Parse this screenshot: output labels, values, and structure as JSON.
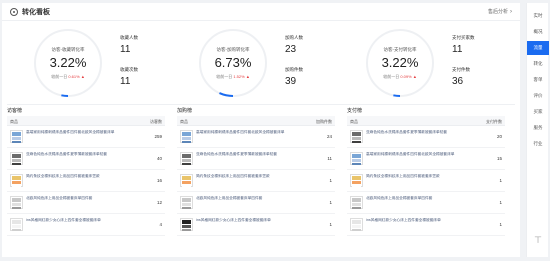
{
  "header": {
    "title": "转化看板",
    "link_label": "售后分析",
    "icon": "settings-icon"
  },
  "metrics": [
    {
      "ring_label": "访客-收藏转化率",
      "ring_value": "3.22%",
      "compare_label": "较前一日",
      "compare_value": "0.61%",
      "compare_arrow": "▲",
      "progress_fraction": 0.0322,
      "kpis": [
        {
          "label": "收藏人数",
          "value": "11"
        },
        {
          "label": "收藏次数",
          "value": "11"
        }
      ]
    },
    {
      "ring_label": "访客-加购转化率",
      "ring_value": "6.73%",
      "compare_label": "较前一日",
      "compare_value": "1.52%",
      "compare_arrow": "▲",
      "progress_fraction": 0.0673,
      "kpis": [
        {
          "label": "加购人数",
          "value": "23"
        },
        {
          "label": "加购件数",
          "value": "39"
        }
      ]
    },
    {
      "ring_label": "访客-支付转化率",
      "ring_value": "3.22%",
      "compare_label": "较前一日",
      "compare_value": "0.09%",
      "compare_arrow": "▲",
      "progress_fraction": 0.0322,
      "kpis": [
        {
          "label": "支付买家数",
          "value": "11"
        },
        {
          "label": "支付件数",
          "value": "36"
        }
      ]
    }
  ],
  "rankings": [
    {
      "title": "访客榜",
      "col_product": "商品",
      "col_value": "访客数",
      "rows": [
        {
          "title": "高端家用纯棉刺绣床品套件四件套北欧风全棉被套床单",
          "value": "259",
          "thumb": "blue"
        },
        {
          "title": "亚麻色纯色水洗棉床品套件夏季薄款被套床单枕套",
          "value": "40",
          "thumb": "dark"
        },
        {
          "title": "简约条纹全棉斜纹床上用品四件套被套床笠款",
          "value": "16",
          "thumb": "yellow"
        },
        {
          "title": "北欧风纯色床上用品全棉被套床单四件套",
          "value": "12",
          "thumb": "gray"
        },
        {
          "title": "ins风格网红款少女心床上四件套全棉被套床单",
          "value": "4",
          "thumb": "white"
        }
      ]
    },
    {
      "title": "加购榜",
      "col_product": "商品",
      "col_value": "加购件数",
      "rows": [
        {
          "title": "高端家用纯棉刺绣床品套件四件套北欧风全棉被套床单",
          "value": "24",
          "thumb": "blue"
        },
        {
          "title": "亚麻色纯色水洗棉床品套件夏季薄款被套床单枕套",
          "value": "11",
          "thumb": "dark"
        },
        {
          "title": "简约条纹全棉斜纹床上用品四件套被套床笠款",
          "value": "1",
          "thumb": "yellow"
        },
        {
          "title": "北欧风纯色床上用品全棉被套床单四件套",
          "value": "1",
          "thumb": "gray"
        },
        {
          "title": "ins风格网红款少女心床上四件套全棉被套床单",
          "value": "1",
          "thumb": "black"
        }
      ]
    },
    {
      "title": "支付榜",
      "col_product": "商品",
      "col_value": "支付件数",
      "rows": [
        {
          "title": "亚麻色纯色水洗棉床品套件夏季薄款被套床单枕套",
          "value": "20",
          "thumb": "dark"
        },
        {
          "title": "高端家用纯棉刺绣床品套件四件套北欧风全棉被套床单",
          "value": "15",
          "thumb": "blue"
        },
        {
          "title": "简约条纹全棉斜纹床上用品四件套被套床笠款",
          "value": "1",
          "thumb": "yellow"
        },
        {
          "title": "北欧风纯色床上用品全棉被套床单四件套",
          "value": "1",
          "thumb": "gray"
        },
        {
          "title": "ins风格网红款少女心床上四件套全棉被套床单",
          "value": "1",
          "thumb": "white"
        }
      ]
    }
  ],
  "sidebar": {
    "items": [
      "实时",
      "概况",
      "流量",
      "转化",
      "客单",
      "评价",
      "买家",
      "服务",
      "行业"
    ],
    "active_index": 2,
    "top_icon": "pin-to-top-icon",
    "top_glyph": "⊤"
  },
  "colors": {
    "accent": "#1a6bf0",
    "up": "#e4393c",
    "ring_track": "#eef0f3"
  }
}
